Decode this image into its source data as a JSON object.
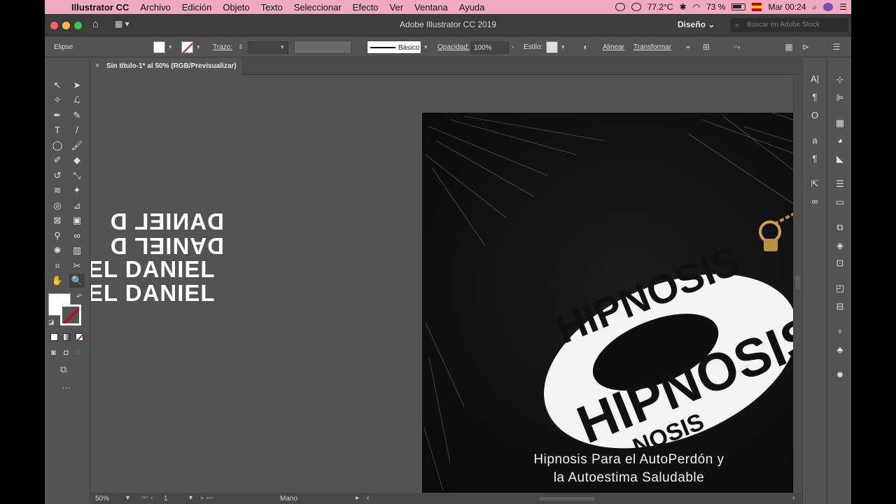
{
  "menubar": {
    "app": "Illustrator CC",
    "items": [
      "Archivo",
      "Edición",
      "Objeto",
      "Texto",
      "Seleccionar",
      "Efecto",
      "Ver",
      "Ventana",
      "Ayuda"
    ],
    "temperature": "77.2°C",
    "battery": "73 %",
    "clock": "Mar 00:24"
  },
  "titlebar": {
    "title": "Adobe Illustrator CC 2019",
    "workspace": "Diseño",
    "search_placeholder": "Buscar en Adobe Stock"
  },
  "control": {
    "object_type": "Elipse",
    "stroke_label": "Trazo:",
    "stroke_style": "Básico",
    "opacity_label": "Opacidad:",
    "opacity_value": "100%",
    "style_label": "Estilo:",
    "align_label": "Alinear",
    "transform_label": "Transformar"
  },
  "document": {
    "tab_title": "Sin título-1* al 50% (RGB/Previsualizar)",
    "close": "×"
  },
  "canvas": {
    "daniel_lines": [
      "DANIEL D",
      "DANIEL D",
      "EL DANIEL",
      "EL DANIEL"
    ],
    "artboard_texts": [
      "HIPNOSIS",
      "HIPNOSIS",
      "NOSIS"
    ],
    "caption_line1": "Hipnosis Para el AutoPerdón y",
    "caption_line2": "la Autoestima Saludable"
  },
  "status": {
    "zoom": "50%",
    "page": "1",
    "tool": "Mano"
  },
  "colors": {
    "menubar": "#f0aabf",
    "ui_bg": "#535353",
    "title_bg": "#3c3c3c",
    "artboard": "#111111"
  }
}
